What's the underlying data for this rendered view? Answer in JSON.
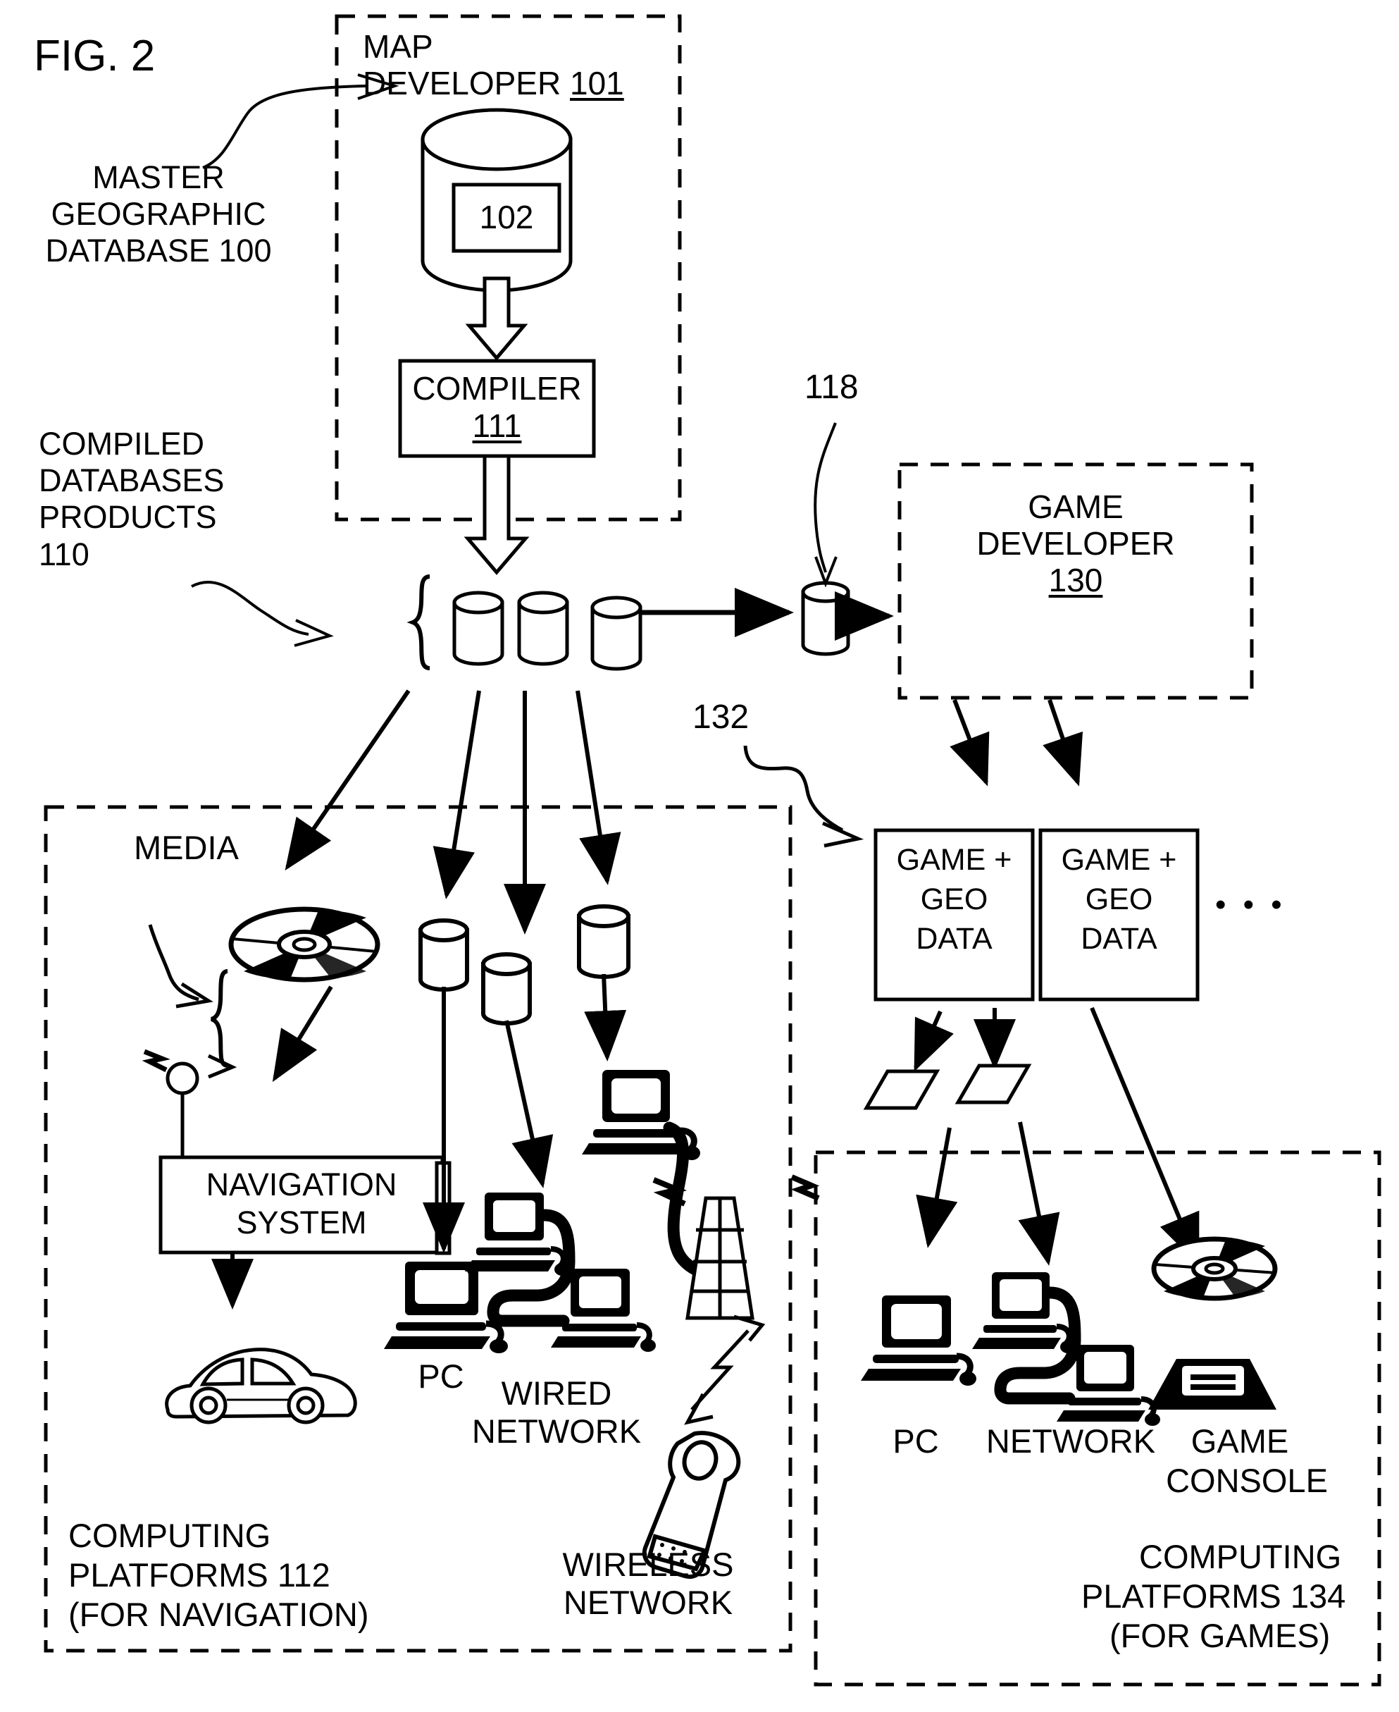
{
  "figure": {
    "label": "FIG. 2"
  },
  "annotations": {
    "master_db": "MASTER\nGEOGRAPHIC\nDATABASE 100",
    "compiled": "COMPILED\nDATABASES\nPRODUCTS\n110",
    "ref_118": "118",
    "ref_132": "132"
  },
  "map_developer": {
    "title_line1": "MAP",
    "title_line2": "DEVELOPER ",
    "title_ref": "101",
    "database_ref": "102",
    "compiler_label": "COMPILER",
    "compiler_ref": "111"
  },
  "game_developer": {
    "title_line1": "GAME",
    "title_line2": "DEVELOPER",
    "ref": "130"
  },
  "game_geo_boxes": [
    {
      "line1": "GAME +",
      "line2": "GEO",
      "line3": "DATA"
    },
    {
      "line1": "GAME +",
      "line2": "GEO",
      "line3": "DATA"
    }
  ],
  "ellipsis": "• • •",
  "nav_platforms": {
    "media_label": "MEDIA",
    "navigation_system_line1": "NAVIGATION",
    "navigation_system_line2": "SYSTEM",
    "pc_label": "PC",
    "wired_network_line1": "WIRED",
    "wired_network_line2": "NETWORK",
    "wireless_network_line1": "WIRELESS",
    "wireless_network_line2": "NETWORK",
    "caption_line1": "COMPUTING",
    "caption_line2": "PLATFORMS 112",
    "caption_line3": "(FOR NAVIGATION)"
  },
  "game_platforms": {
    "pc_label": "PC",
    "network_label": "NETWORK",
    "console_line1": "GAME",
    "console_line2": "CONSOLE",
    "caption_line1": "COMPUTING",
    "caption_line2": "PLATFORMS 134",
    "caption_line3": "(FOR GAMES)"
  },
  "colors": {
    "ink": "#000000",
    "paper": "#ffffff"
  }
}
